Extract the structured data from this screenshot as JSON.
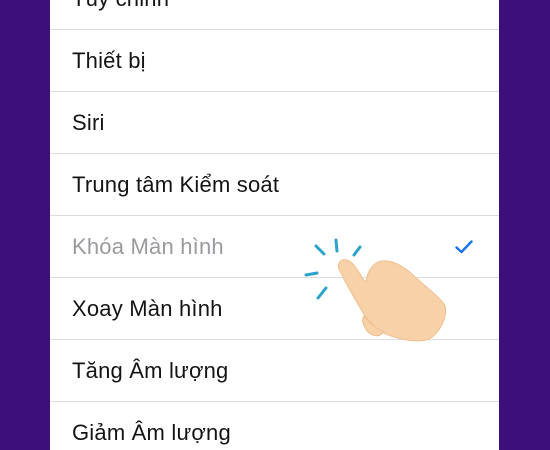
{
  "menu": {
    "items": [
      {
        "label": "Tùy chỉnh",
        "checked": false,
        "disabled": false
      },
      {
        "label": "Thiết bị",
        "checked": false,
        "disabled": false
      },
      {
        "label": "Siri",
        "checked": false,
        "disabled": false
      },
      {
        "label": "Trung tâm Kiểm soát",
        "checked": false,
        "disabled": false
      },
      {
        "label": "Khóa Màn hình",
        "checked": true,
        "disabled": true
      },
      {
        "label": "Xoay Màn hình",
        "checked": false,
        "disabled": false
      },
      {
        "label": "Tăng Âm lượng",
        "checked": false,
        "disabled": false
      },
      {
        "label": "Giảm Âm lượng",
        "checked": false,
        "disabled": false
      }
    ]
  },
  "colors": {
    "background": "#3c0f7a",
    "panel": "#ffffff",
    "check": "#1a73e8",
    "tap_lines": "#29a3c9",
    "hand": "#f7d1a8"
  },
  "icons": {
    "check": "check-icon",
    "tap": "tap-hand-icon"
  }
}
